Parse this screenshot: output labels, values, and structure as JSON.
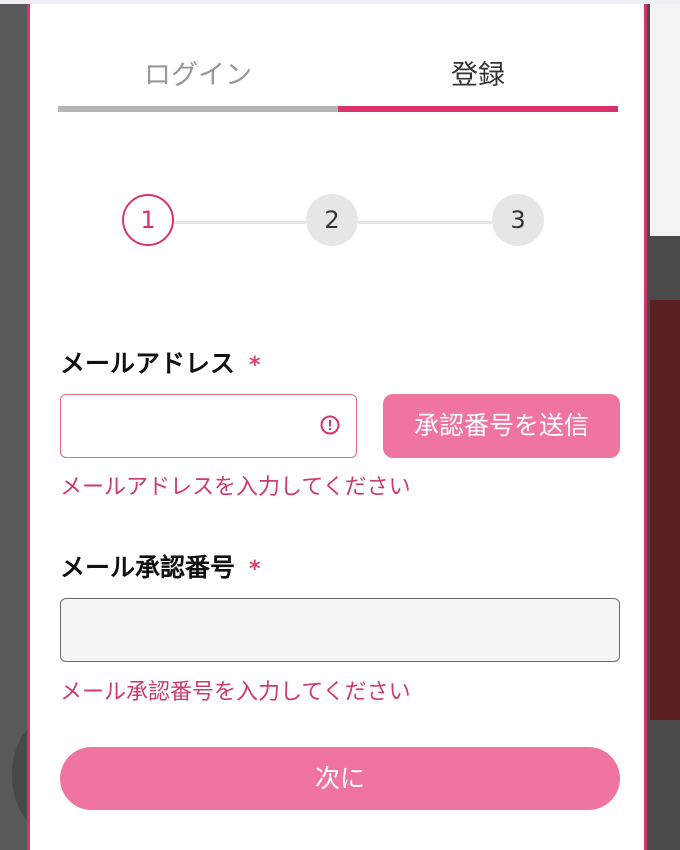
{
  "tabs": [
    {
      "label": "ログイン"
    },
    {
      "label": "登録"
    }
  ],
  "steps": [
    "1",
    "2",
    "3"
  ],
  "email": {
    "label": "メールアドレス",
    "required_mark": "*",
    "value": "",
    "send_button": "承認番号を送信",
    "error": "メールアドレスを入力してください"
  },
  "code": {
    "label": "メール承認番号",
    "required_mark": "*",
    "value": "",
    "error": "メール承認番号を入力してください"
  },
  "next_button": "次に",
  "colors": {
    "accent": "#d8336b",
    "button": "#ef74a0",
    "error_text": "#cf3a6d"
  }
}
